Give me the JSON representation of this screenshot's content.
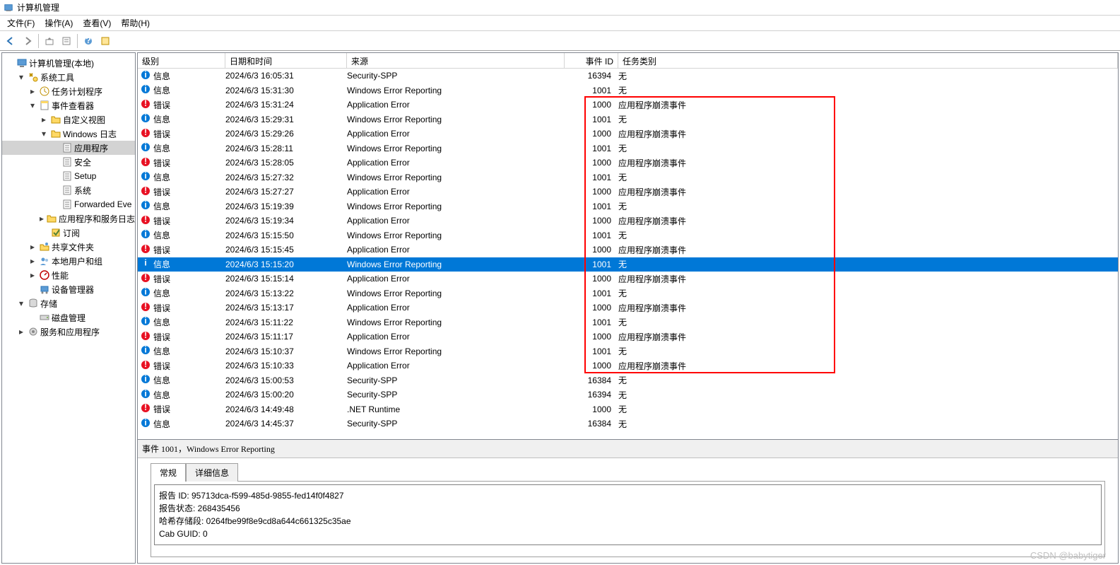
{
  "window": {
    "title": "计算机管理"
  },
  "menus": [
    "文件(F)",
    "操作(A)",
    "查看(V)",
    "帮助(H)"
  ],
  "tree": [
    {
      "d": 0,
      "tw": "",
      "icon": "comp",
      "label": "计算机管理(本地)"
    },
    {
      "d": 1,
      "tw": "v",
      "icon": "tools",
      "label": "系统工具"
    },
    {
      "d": 2,
      "tw": ">",
      "icon": "task",
      "label": "任务计划程序"
    },
    {
      "d": 2,
      "tw": "v",
      "icon": "event",
      "label": "事件查看器"
    },
    {
      "d": 3,
      "tw": ">",
      "icon": "folder",
      "label": "自定义视图"
    },
    {
      "d": 3,
      "tw": "v",
      "icon": "folder",
      "label": "Windows 日志"
    },
    {
      "d": 4,
      "tw": "",
      "icon": "log",
      "label": "应用程序",
      "sel": true
    },
    {
      "d": 4,
      "tw": "",
      "icon": "log",
      "label": "安全"
    },
    {
      "d": 4,
      "tw": "",
      "icon": "log",
      "label": "Setup"
    },
    {
      "d": 4,
      "tw": "",
      "icon": "log",
      "label": "系统"
    },
    {
      "d": 4,
      "tw": "",
      "icon": "log",
      "label": "Forwarded Eve"
    },
    {
      "d": 3,
      "tw": ">",
      "icon": "folder",
      "label": "应用程序和服务日志"
    },
    {
      "d": 3,
      "tw": "",
      "icon": "sub",
      "label": "订阅"
    },
    {
      "d": 2,
      "tw": ">",
      "icon": "share",
      "label": "共享文件夹"
    },
    {
      "d": 2,
      "tw": ">",
      "icon": "users",
      "label": "本地用户和组"
    },
    {
      "d": 2,
      "tw": ">",
      "icon": "perf",
      "label": "性能"
    },
    {
      "d": 2,
      "tw": "",
      "icon": "dev",
      "label": "设备管理器"
    },
    {
      "d": 1,
      "tw": "v",
      "icon": "storage",
      "label": "存储"
    },
    {
      "d": 2,
      "tw": "",
      "icon": "disk",
      "label": "磁盘管理"
    },
    {
      "d": 1,
      "tw": ">",
      "icon": "svc",
      "label": "服务和应用程序"
    }
  ],
  "columns": {
    "level": "级别",
    "date": "日期和时间",
    "source": "来源",
    "id": "事件 ID",
    "cat": "任务类别"
  },
  "events": [
    {
      "lv": "信息",
      "t": "info",
      "dt": "2024/6/3 16:05:31",
      "sr": "Security-SPP",
      "id": "16394",
      "ct": "无"
    },
    {
      "lv": "信息",
      "t": "info",
      "dt": "2024/6/3 15:31:30",
      "sr": "Windows Error Reporting",
      "id": "1001",
      "ct": "无"
    },
    {
      "lv": "错误",
      "t": "err",
      "dt": "2024/6/3 15:31:24",
      "sr": "Application Error",
      "id": "1000",
      "ct": "应用程序崩溃事件"
    },
    {
      "lv": "信息",
      "t": "info",
      "dt": "2024/6/3 15:29:31",
      "sr": "Windows Error Reporting",
      "id": "1001",
      "ct": "无"
    },
    {
      "lv": "错误",
      "t": "err",
      "dt": "2024/6/3 15:29:26",
      "sr": "Application Error",
      "id": "1000",
      "ct": "应用程序崩溃事件"
    },
    {
      "lv": "信息",
      "t": "info",
      "dt": "2024/6/3 15:28:11",
      "sr": "Windows Error Reporting",
      "id": "1001",
      "ct": "无"
    },
    {
      "lv": "错误",
      "t": "err",
      "dt": "2024/6/3 15:28:05",
      "sr": "Application Error",
      "id": "1000",
      "ct": "应用程序崩溃事件"
    },
    {
      "lv": "信息",
      "t": "info",
      "dt": "2024/6/3 15:27:32",
      "sr": "Windows Error Reporting",
      "id": "1001",
      "ct": "无"
    },
    {
      "lv": "错误",
      "t": "err",
      "dt": "2024/6/3 15:27:27",
      "sr": "Application Error",
      "id": "1000",
      "ct": "应用程序崩溃事件"
    },
    {
      "lv": "信息",
      "t": "info",
      "dt": "2024/6/3 15:19:39",
      "sr": "Windows Error Reporting",
      "id": "1001",
      "ct": "无"
    },
    {
      "lv": "错误",
      "t": "err",
      "dt": "2024/6/3 15:19:34",
      "sr": "Application Error",
      "id": "1000",
      "ct": "应用程序崩溃事件"
    },
    {
      "lv": "信息",
      "t": "info",
      "dt": "2024/6/3 15:15:50",
      "sr": "Windows Error Reporting",
      "id": "1001",
      "ct": "无"
    },
    {
      "lv": "错误",
      "t": "err",
      "dt": "2024/6/3 15:15:45",
      "sr": "Application Error",
      "id": "1000",
      "ct": "应用程序崩溃事件"
    },
    {
      "lv": "信息",
      "t": "info",
      "dt": "2024/6/3 15:15:20",
      "sr": "Windows Error Reporting",
      "id": "1001",
      "ct": "无",
      "sel": true
    },
    {
      "lv": "错误",
      "t": "err",
      "dt": "2024/6/3 15:15:14",
      "sr": "Application Error",
      "id": "1000",
      "ct": "应用程序崩溃事件"
    },
    {
      "lv": "信息",
      "t": "info",
      "dt": "2024/6/3 15:13:22",
      "sr": "Windows Error Reporting",
      "id": "1001",
      "ct": "无"
    },
    {
      "lv": "错误",
      "t": "err",
      "dt": "2024/6/3 15:13:17",
      "sr": "Application Error",
      "id": "1000",
      "ct": "应用程序崩溃事件"
    },
    {
      "lv": "信息",
      "t": "info",
      "dt": "2024/6/3 15:11:22",
      "sr": "Windows Error Reporting",
      "id": "1001",
      "ct": "无"
    },
    {
      "lv": "错误",
      "t": "err",
      "dt": "2024/6/3 15:11:17",
      "sr": "Application Error",
      "id": "1000",
      "ct": "应用程序崩溃事件"
    },
    {
      "lv": "信息",
      "t": "info",
      "dt": "2024/6/3 15:10:37",
      "sr": "Windows Error Reporting",
      "id": "1001",
      "ct": "无"
    },
    {
      "lv": "错误",
      "t": "err",
      "dt": "2024/6/3 15:10:33",
      "sr": "Application Error",
      "id": "1000",
      "ct": "应用程序崩溃事件"
    },
    {
      "lv": "信息",
      "t": "info",
      "dt": "2024/6/3 15:00:53",
      "sr": "Security-SPP",
      "id": "16384",
      "ct": "无"
    },
    {
      "lv": "信息",
      "t": "info",
      "dt": "2024/6/3 15:00:20",
      "sr": "Security-SPP",
      "id": "16394",
      "ct": "无"
    },
    {
      "lv": "错误",
      "t": "err",
      "dt": "2024/6/3 14:49:48",
      "sr": ".NET Runtime",
      "id": "1000",
      "ct": "无"
    },
    {
      "lv": "信息",
      "t": "info",
      "dt": "2024/6/3 14:45:37",
      "sr": "Security-SPP",
      "id": "16384",
      "ct": "无"
    }
  ],
  "detail": {
    "header": "事件 1001，Windows Error Reporting",
    "tabs": {
      "general": "常规",
      "details": "详细信息"
    },
    "lines": [
      "报告 ID: 95713dca-f599-485d-9855-fed14f0f4827",
      "报告状态: 268435456",
      "哈希存储段: 0264fbe99f8e9cd8a644c661325c35ae",
      "Cab GUID: 0"
    ]
  },
  "watermark": "CSDN @babytiger"
}
